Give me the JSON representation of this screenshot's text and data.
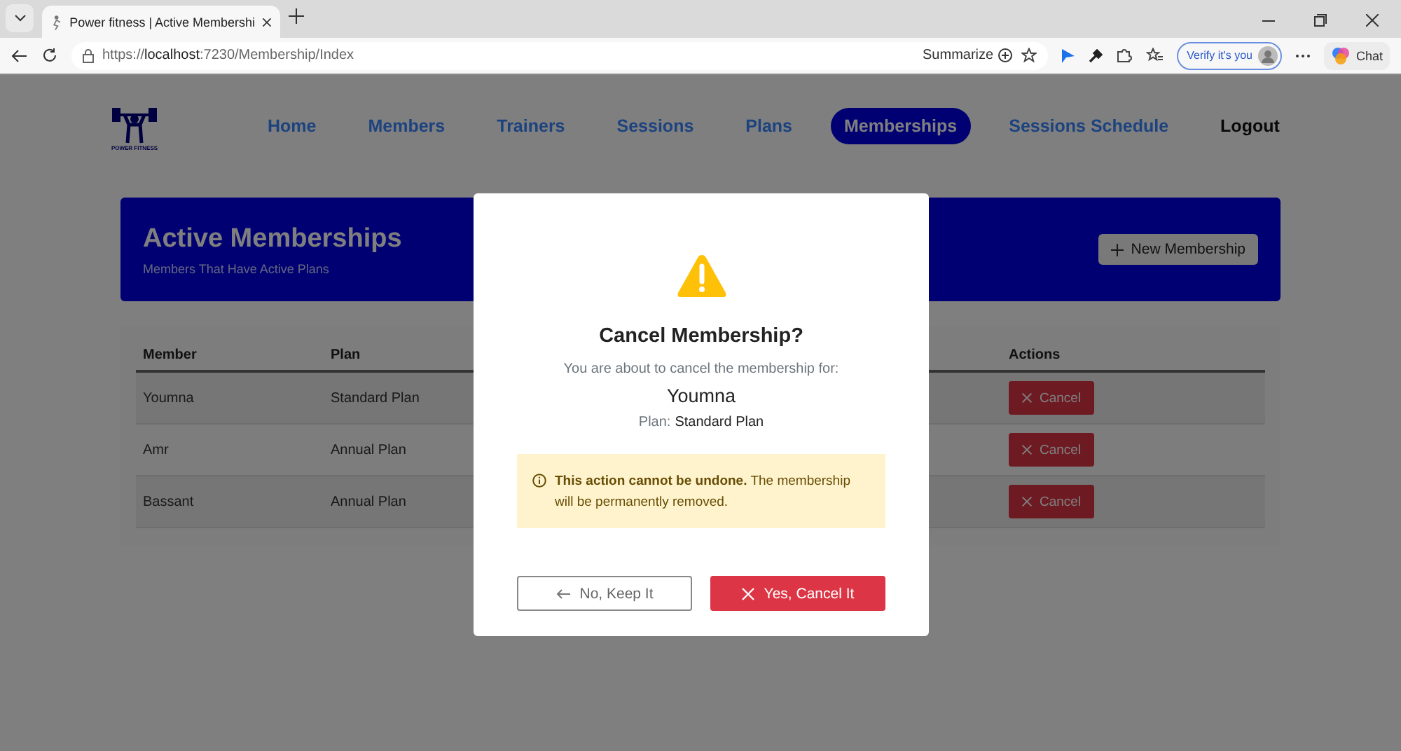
{
  "browser": {
    "tab_title": "Power fitness | Active Membershi",
    "url": "https://**localhost**:7230/Membership/Index",
    "summarize": "Summarize",
    "verify": "Verify it's you",
    "chat": "Chat"
  },
  "logo_text": "POWER FITNESS",
  "nav": [
    {
      "label": "Home",
      "kind": "link",
      "selected": false
    },
    {
      "label": "Members",
      "kind": "link",
      "selected": false
    },
    {
      "label": "Trainers",
      "kind": "link",
      "selected": false
    },
    {
      "label": "Sessions",
      "kind": "link",
      "selected": false
    },
    {
      "label": "Plans",
      "kind": "link",
      "selected": false
    },
    {
      "label": "Memberships",
      "kind": "link",
      "selected": true
    },
    {
      "label": "Sessions Schedule",
      "kind": "link",
      "selected": false
    },
    {
      "label": "Logout",
      "kind": "logout",
      "selected": false
    }
  ],
  "header": {
    "title": "Active Memberships",
    "subtitle": "Members That Have Active Plans",
    "button": "New Membership"
  },
  "table": {
    "columns": [
      "Member",
      "Plan",
      "Actions"
    ],
    "rows": [
      {
        "member": "Youmna",
        "plan": "Standard Plan",
        "action": "Cancel"
      },
      {
        "member": "Amr",
        "plan": "Annual Plan",
        "action": "Cancel"
      },
      {
        "member": "Bassant",
        "plan": "Annual Plan",
        "action": "Cancel"
      }
    ]
  },
  "modal": {
    "title": "Cancel Membership?",
    "message": "You are about to cancel the membership for:",
    "member": "Youmna",
    "plan_label": "Plan:",
    "plan": "Standard Plan",
    "warning": "**This action cannot be undone.** The membership will be permanently removed.",
    "buttons": [
      {
        "label": "No, Keep It",
        "kind": "secondary"
      },
      {
        "label": "Yes, Cancel It",
        "kind": "danger"
      }
    ]
  }
}
